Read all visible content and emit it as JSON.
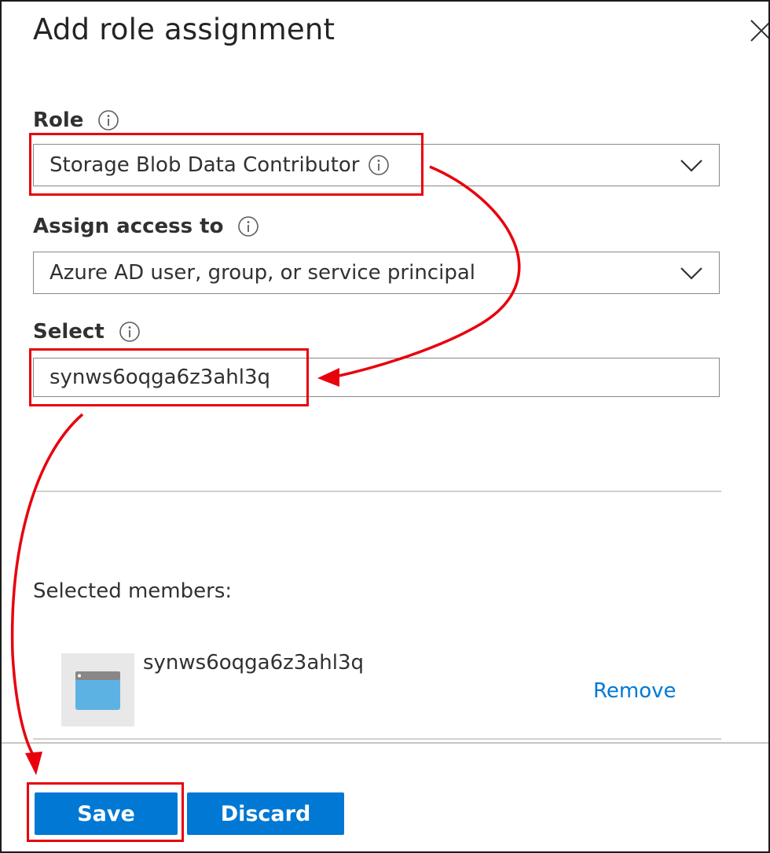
{
  "dialog": {
    "title": "Add role assignment",
    "close_icon": "close-icon"
  },
  "role": {
    "label": "Role",
    "value": "Storage Blob Data Contributor"
  },
  "assign_access": {
    "label": "Assign access to",
    "value": "Azure AD user, group, or service principal"
  },
  "select": {
    "label": "Select",
    "value": "synws6oqga6z3ahl3q"
  },
  "members": {
    "label": "Selected members:",
    "items": [
      {
        "name": "synws6oqga6z3ahl3q",
        "icon": "app-window-icon",
        "remove_label": "Remove"
      }
    ]
  },
  "footer": {
    "save_label": "Save",
    "discard_label": "Discard"
  },
  "colors": {
    "accent": "#0078d4",
    "annotation": "#e8000d",
    "member_icon": "#5db2e4"
  }
}
